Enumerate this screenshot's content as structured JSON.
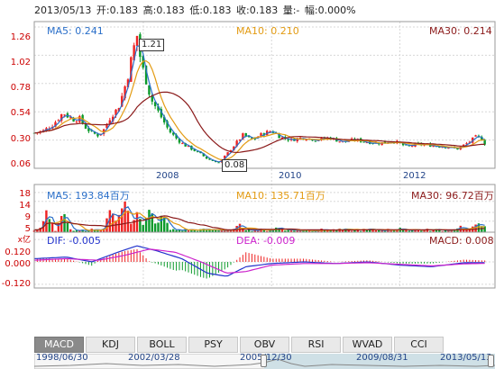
{
  "info": {
    "date": "2013/05/13",
    "open": "开:0.183",
    "high": "高:0.183",
    "low": "低:0.183",
    "close": "收:0.183",
    "volume": "量:-",
    "change": "幅:0.000%"
  },
  "colors": {
    "up": "#ee2222",
    "down": "#0a9a2a",
    "ma5": "#2a6fc9",
    "ma10": "#e39b12",
    "ma30": "#8b1a1a",
    "dif": "#2233cc",
    "dea": "#cc22cc",
    "axis_text": "#cc0000",
    "grid": "#d8d8d8"
  },
  "price_panel": {
    "ma5": "MA5: 0.241",
    "ma10": "MA10: 0.210",
    "ma30": "MA30: 0.214",
    "y_ticks": [
      "1.26",
      "1.02",
      "0.78",
      "0.54",
      "0.30",
      "0.06"
    ],
    "x_ticks": [
      "2008",
      "2010",
      "2012"
    ],
    "high_marker": "1.21",
    "low_marker": "0.08"
  },
  "volume_panel": {
    "ma5": "MA5: 193.84百万",
    "ma10": "MA10: 135.71百万",
    "ma30": "MA30: 96.72百万",
    "y_ticks": [
      "18",
      "14",
      "9",
      "5"
    ],
    "unit": "x亿"
  },
  "macd_panel": {
    "dif": "DIF: -0.005",
    "dea": "DEA: -0.009",
    "macd": "MACD: 0.008",
    "y_ticks": [
      "0.120",
      "0.000",
      "-0.120"
    ]
  },
  "tabs": [
    "MACD",
    "KDJ",
    "BOLL",
    "PSY",
    "OBV",
    "RSI",
    "WVAD",
    "CCI"
  ],
  "active_tab": "MACD",
  "navigator": {
    "dates": [
      "1998/06/30",
      "2002/03/28",
      "2005/12/30",
      "2009/08/31",
      "2013/05/13"
    ]
  },
  "chart_data": [
    {
      "type": "candlestick",
      "title": "2013/05/13",
      "x_ticks": [
        "2008",
        "2010",
        "2012"
      ],
      "ylim": [
        0.06,
        1.26
      ],
      "y_ticks": [
        1.26,
        1.02,
        0.78,
        0.54,
        0.3,
        0.06
      ],
      "x_range": [
        2006.3,
        2013.37
      ],
      "series": [
        {
          "name": "MA5",
          "last_value": 0.241
        },
        {
          "name": "MA10",
          "last_value": 0.21
        },
        {
          "name": "MA30",
          "last_value": 0.214
        }
      ],
      "close_path": [
        [
          2006.3,
          0.34
        ],
        [
          2006.45,
          0.36
        ],
        [
          2006.6,
          0.42
        ],
        [
          2006.75,
          0.52
        ],
        [
          2006.9,
          0.46
        ],
        [
          2007.0,
          0.47
        ],
        [
          2007.1,
          0.39
        ],
        [
          2007.2,
          0.34
        ],
        [
          2007.3,
          0.32
        ],
        [
          2007.4,
          0.38
        ],
        [
          2007.5,
          0.5
        ],
        [
          2007.6,
          0.55
        ],
        [
          2007.7,
          0.72
        ],
        [
          2007.78,
          0.9
        ],
        [
          2007.84,
          1.06
        ],
        [
          2007.9,
          1.21
        ],
        [
          2007.97,
          0.94
        ],
        [
          2008.05,
          0.8
        ],
        [
          2008.12,
          0.64
        ],
        [
          2008.2,
          0.56
        ],
        [
          2008.3,
          0.46
        ],
        [
          2008.4,
          0.36
        ],
        [
          2008.5,
          0.3
        ],
        [
          2008.62,
          0.24
        ],
        [
          2008.75,
          0.2
        ],
        [
          2008.88,
          0.16
        ],
        [
          2009.0,
          0.11
        ],
        [
          2009.1,
          0.09
        ],
        [
          2009.18,
          0.08
        ],
        [
          2009.28,
          0.14
        ],
        [
          2009.4,
          0.22
        ],
        [
          2009.55,
          0.32
        ],
        [
          2009.7,
          0.28
        ],
        [
          2009.85,
          0.33
        ],
        [
          2010.0,
          0.36
        ],
        [
          2010.15,
          0.3
        ],
        [
          2010.3,
          0.28
        ],
        [
          2010.5,
          0.3
        ],
        [
          2010.7,
          0.28
        ],
        [
          2010.9,
          0.3
        ],
        [
          2011.1,
          0.26
        ],
        [
          2011.3,
          0.28
        ],
        [
          2011.5,
          0.26
        ],
        [
          2011.7,
          0.25
        ],
        [
          2011.9,
          0.27
        ],
        [
          2012.1,
          0.22
        ],
        [
          2012.3,
          0.24
        ],
        [
          2012.5,
          0.23
        ],
        [
          2012.7,
          0.22
        ],
        [
          2012.9,
          0.2
        ],
        [
          2013.05,
          0.25
        ],
        [
          2013.2,
          0.31
        ],
        [
          2013.3,
          0.28
        ],
        [
          2013.37,
          0.183
        ]
      ]
    },
    {
      "type": "bar",
      "title": "",
      "ylabel": "x亿",
      "ylim": [
        0,
        20
      ],
      "y_ticks": [
        18,
        14,
        9,
        5
      ],
      "series": [
        {
          "name": "MA5",
          "last_value": "193.84百万"
        },
        {
          "name": "MA10",
          "last_value": "135.71百万"
        },
        {
          "name": "MA30",
          "last_value": "96.72百万"
        }
      ],
      "volume_peaks": [
        [
          2006.5,
          11.0
        ],
        [
          2006.75,
          10.0
        ],
        [
          2007.5,
          12.0
        ],
        [
          2007.7,
          18.0
        ],
        [
          2007.9,
          10.0
        ],
        [
          2008.1,
          13.0
        ],
        [
          2008.3,
          9.0
        ],
        [
          2009.5,
          4.0
        ],
        [
          2010.1,
          3.0
        ],
        [
          2012.0,
          2.0
        ],
        [
          2012.95,
          3.0
        ],
        [
          2013.2,
          5.0
        ],
        [
          2013.3,
          4.0
        ]
      ]
    },
    {
      "type": "line",
      "title": "MACD",
      "ylim": [
        -0.14,
        0.14
      ],
      "y_ticks": [
        0.12,
        0.0,
        -0.12
      ],
      "series": [
        {
          "name": "DIF",
          "last_value": -0.005
        },
        {
          "name": "DEA",
          "last_value": -0.009
        },
        {
          "name": "MACD",
          "last_value": 0.008
        }
      ],
      "dif_path": [
        [
          2006.3,
          0.02
        ],
        [
          2006.8,
          0.03
        ],
        [
          2007.2,
          0.0
        ],
        [
          2007.6,
          0.06
        ],
        [
          2007.9,
          0.1
        ],
        [
          2008.2,
          0.07
        ],
        [
          2008.6,
          0.02
        ],
        [
          2009.0,
          -0.07
        ],
        [
          2009.3,
          -0.09
        ],
        [
          2009.6,
          -0.03
        ],
        [
          2010.0,
          -0.01
        ],
        [
          2010.5,
          0.0
        ],
        [
          2011.0,
          -0.01
        ],
        [
          2011.5,
          0.0
        ],
        [
          2012.0,
          -0.02
        ],
        [
          2012.5,
          -0.03
        ],
        [
          2013.0,
          -0.005
        ],
        [
          2013.37,
          -0.005
        ]
      ],
      "dea_path": [
        [
          2006.3,
          0.01
        ],
        [
          2006.8,
          0.02
        ],
        [
          2007.3,
          0.01
        ],
        [
          2007.7,
          0.04
        ],
        [
          2008.1,
          0.08
        ],
        [
          2008.5,
          0.06
        ],
        [
          2008.9,
          0.0
        ],
        [
          2009.3,
          -0.07
        ],
        [
          2009.6,
          -0.06
        ],
        [
          2010.0,
          -0.02
        ],
        [
          2010.5,
          -0.01
        ],
        [
          2011.0,
          -0.01
        ],
        [
          2011.5,
          -0.005
        ],
        [
          2012.0,
          -0.015
        ],
        [
          2012.5,
          -0.025
        ],
        [
          2013.0,
          -0.012
        ],
        [
          2013.37,
          -0.009
        ]
      ]
    }
  ]
}
